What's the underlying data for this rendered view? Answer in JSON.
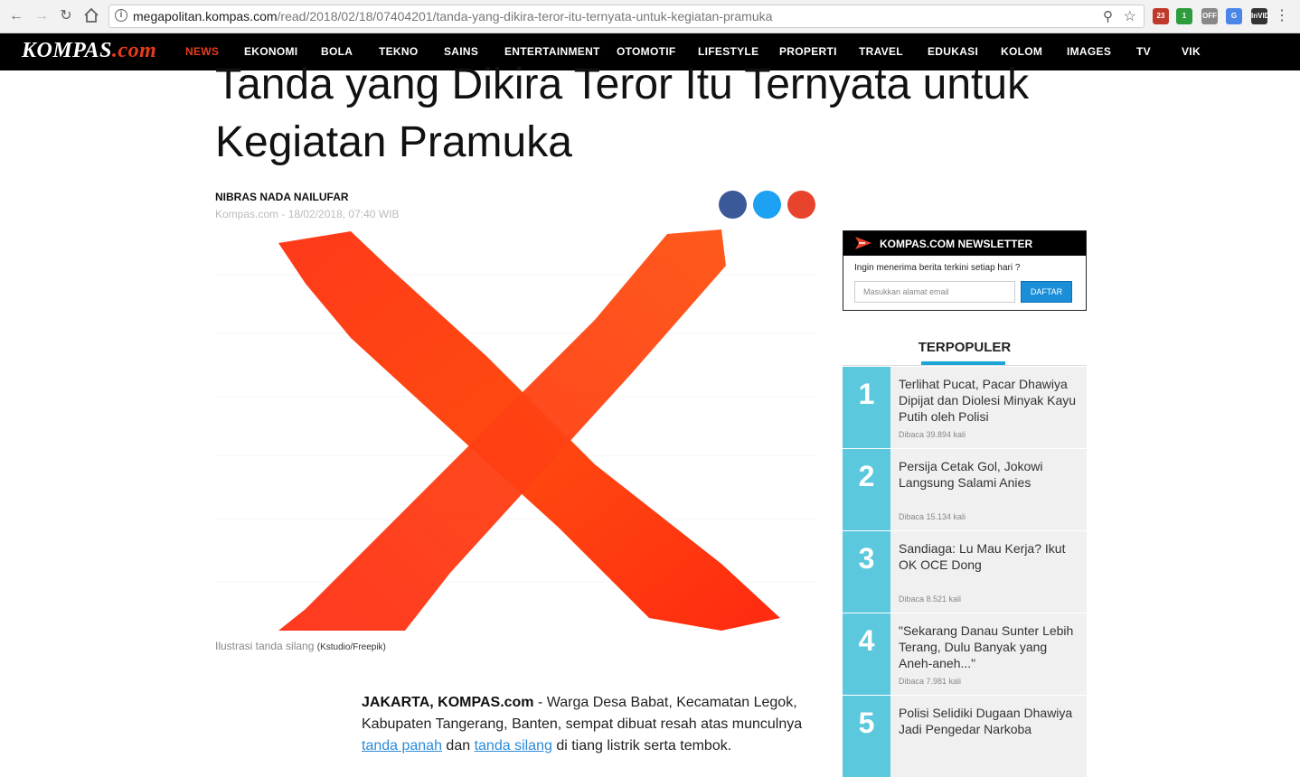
{
  "browser": {
    "url_host": "megapolitan.kompas.com",
    "url_path": "/read/2018/02/18/07404201/tanda-yang-dikira-teror-itu-ternyata-untuk-kegiatan-pramuka",
    "extensions": [
      {
        "name": "calendar-extension",
        "label": "23",
        "color": "#c0392b"
      },
      {
        "name": "green-extension",
        "label": "1",
        "color": "#2e9b3d"
      },
      {
        "name": "off-extension",
        "label": "OFF",
        "color": "#888888"
      },
      {
        "name": "translate-extension",
        "label": "G",
        "color": "#4a86e8"
      },
      {
        "name": "invid-extension",
        "label": "InVID",
        "color": "#333333"
      }
    ]
  },
  "site": {
    "logo_main": "KOMPAS",
    "logo_suffix": ".com",
    "nav": [
      {
        "label": "NEWS",
        "active": true
      },
      {
        "label": "EKONOMI"
      },
      {
        "label": "BOLA"
      },
      {
        "label": "TEKNO"
      },
      {
        "label": "SAINS"
      },
      {
        "label": "ENTERTAINMENT"
      },
      {
        "label": "OTOMOTIF"
      },
      {
        "label": "LIFESTYLE"
      },
      {
        "label": "PROPERTI"
      },
      {
        "label": "TRAVEL"
      },
      {
        "label": "EDUKASI"
      },
      {
        "label": "KOLOM"
      },
      {
        "label": "IMAGES"
      },
      {
        "label": "TV"
      },
      {
        "label": "VIK"
      }
    ]
  },
  "article": {
    "title": "Tanda yang Dikira Teror Itu Ternyata untuk Kegiatan Pramuka",
    "author": "NIBRAS NADA NAILUFAR",
    "meta": "Kompas.com - 18/02/2018, 07:40 WIB",
    "share_colors": {
      "facebook": "#3b5998",
      "twitter": "#1da1f2",
      "google": "#e8432c"
    },
    "caption": "Ilustrasi tanda silang",
    "credit": "(Kstudio/Freepik)",
    "lead": "JAKARTA, KOMPAS.com",
    "body_1": " - Warga Desa Babat, Kecamatan Legok, Kabupaten Tangerang, Banten, sempat dibuat resah atas munculnya ",
    "link_1": "tanda panah",
    "body_2": " dan ",
    "link_2": "tanda silang",
    "body_3": " di tiang listrik serta tembok."
  },
  "newsletter": {
    "title": "KOMPAS.COM NEWSLETTER",
    "question": "Ingin menerima berita terkini setiap hari ?",
    "placeholder": "Masukkan alamat email",
    "button": "DAFTAR"
  },
  "popular": {
    "title": "TERPOPULER",
    "items": [
      {
        "num": "1",
        "text": "Terlihat Pucat, Pacar Dhawiya Dipijat dan Diolesi Minyak Kayu Putih oleh Polisi",
        "count": "Dibaca 39.894 kali"
      },
      {
        "num": "2",
        "text": "Persija Cetak Gol, Jokowi Langsung Salami Anies",
        "count": "Dibaca 15.134 kali"
      },
      {
        "num": "3",
        "text": "Sandiaga: Lu Mau Kerja? Ikut OK OCE Dong",
        "count": "Dibaca 8.521 kali"
      },
      {
        "num": "4",
        "text": "\"Sekarang Danau Sunter Lebih Terang, Dulu Banyak yang Aneh-aneh...\"",
        "count": "Dibaca 7.981 kali"
      },
      {
        "num": "5",
        "text": "Polisi Selidiki Dugaan Dhawiya Jadi Pengedar Narkoba",
        "count": ""
      }
    ]
  }
}
